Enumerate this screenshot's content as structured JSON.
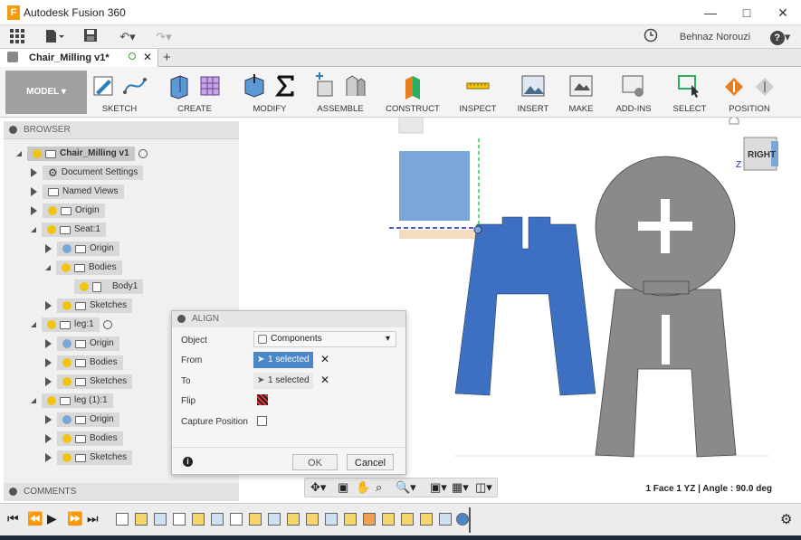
{
  "window": {
    "title": "Autodesk Fusion 360",
    "app_icon_letter": "F"
  },
  "qat": {
    "user_name": "Behnaz Norouzi",
    "help_label": "?"
  },
  "doc_tab": {
    "name": "Chair_Milling v1*",
    "new_tab": "+"
  },
  "ribbon": {
    "workspace": "MODEL",
    "groups": [
      "SKETCH",
      "CREATE",
      "MODIFY",
      "ASSEMBLE",
      "CONSTRUCT",
      "INSPECT",
      "INSERT",
      "MAKE",
      "ADD-INS",
      "SELECT",
      "POSITION"
    ]
  },
  "browser": {
    "header": "BROWSER",
    "nodes": [
      {
        "label": "Chair_Milling v1"
      },
      {
        "label": "Document Settings"
      },
      {
        "label": "Named Views"
      },
      {
        "label": "Origin"
      },
      {
        "label": "Seat:1"
      },
      {
        "label": "Origin"
      },
      {
        "label": "Bodies"
      },
      {
        "label": "Body1"
      },
      {
        "label": "Sketches"
      },
      {
        "label": "leg:1"
      },
      {
        "label": "Origin"
      },
      {
        "label": "Bodies"
      },
      {
        "label": "Sketches"
      },
      {
        "label": "leg (1):1"
      },
      {
        "label": "Origin"
      },
      {
        "label": "Bodies"
      },
      {
        "label": "Sketches"
      }
    ]
  },
  "comments": {
    "label": "COMMENTS"
  },
  "align_dialog": {
    "title": "ALIGN",
    "object_label": "Object",
    "object_value": "Components",
    "from_label": "From",
    "from_value": "1 selected",
    "to_label": "To",
    "to_value": "1 selected",
    "flip_label": "Flip",
    "capture_label": "Capture Position",
    "ok": "OK",
    "cancel": "Cancel"
  },
  "viewcube": {
    "face": "RIGHT",
    "axis": "Z"
  },
  "status": {
    "text": "1 Face 1 YZ | Angle : 90.0 deg"
  },
  "colors": {
    "selection_blue": "#3d6fc2",
    "light_blue": "#7ba7d8",
    "body_gray": "#8a8a8a",
    "ribbon_bg": "#f4f4f4"
  }
}
